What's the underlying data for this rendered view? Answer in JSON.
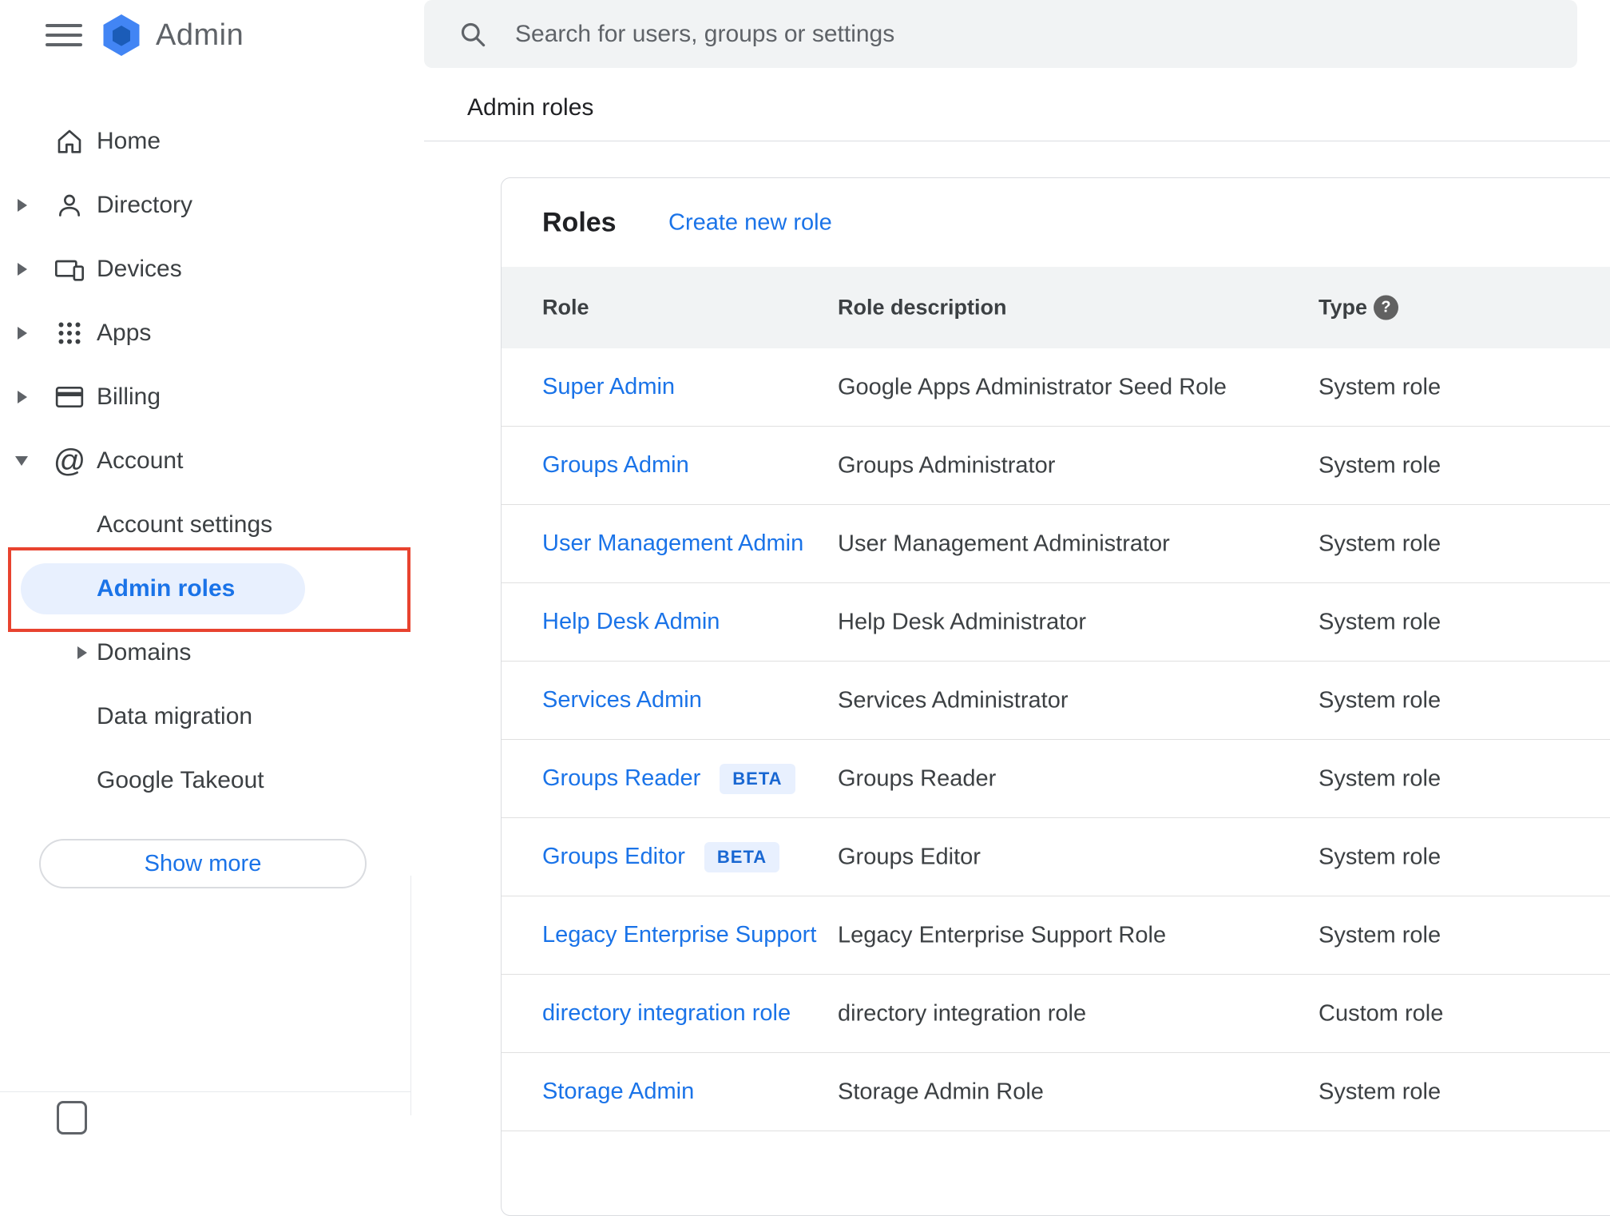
{
  "app": {
    "product_name": "Admin"
  },
  "icons": {
    "account_glyph": "@",
    "help_glyph": "?"
  },
  "sidebar": {
    "items": [
      {
        "label": "Home"
      },
      {
        "label": "Directory"
      },
      {
        "label": "Devices"
      },
      {
        "label": "Apps"
      },
      {
        "label": "Billing"
      },
      {
        "label": "Account"
      }
    ],
    "account_children": [
      {
        "label": "Account settings"
      },
      {
        "label": "Admin roles"
      },
      {
        "label": "Domains"
      },
      {
        "label": "Data migration"
      },
      {
        "label": "Google Takeout"
      }
    ],
    "selected_item": "Admin roles",
    "show_more_label": "Show more"
  },
  "search": {
    "placeholder": "Search for users, groups or settings"
  },
  "breadcrumb": "Admin roles",
  "roles_card": {
    "title": "Roles",
    "create_link_label": "Create new role",
    "columns": {
      "role": "Role",
      "description": "Role description",
      "type": "Type"
    },
    "beta_label": "BETA",
    "rows": [
      {
        "role": "Super Admin",
        "description": "Google Apps Administrator Seed Role",
        "type": "System role"
      },
      {
        "role": "Groups Admin",
        "description": "Groups Administrator",
        "type": "System role"
      },
      {
        "role": "User Management Admin",
        "description": "User Management Administrator",
        "type": "System role"
      },
      {
        "role": "Help Desk Admin",
        "description": "Help Desk Administrator",
        "type": "System role"
      },
      {
        "role": "Services Admin",
        "description": "Services Administrator",
        "type": "System role"
      },
      {
        "role": "Groups Reader",
        "beta": true,
        "description": "Groups Reader",
        "type": "System role"
      },
      {
        "role": "Groups Editor",
        "beta": true,
        "description": "Groups Editor",
        "type": "System role"
      },
      {
        "role": "Legacy Enterprise Support",
        "description": "Legacy Enterprise Support Role",
        "type": "System role"
      },
      {
        "role": "directory integration role",
        "description": "directory integration role",
        "type": "Custom role"
      },
      {
        "role": "Storage Admin",
        "description": "Storage Admin Role",
        "type": "System role"
      }
    ]
  },
  "colors": {
    "accent_blue": "#1a73e8",
    "selected_pill_bg": "#e8f0fe",
    "beta_badge_bg": "#e8f0fe",
    "beta_badge_text": "#1967d2",
    "table_header_bg": "#f1f3f4",
    "annotation_red": "#e8432f"
  }
}
